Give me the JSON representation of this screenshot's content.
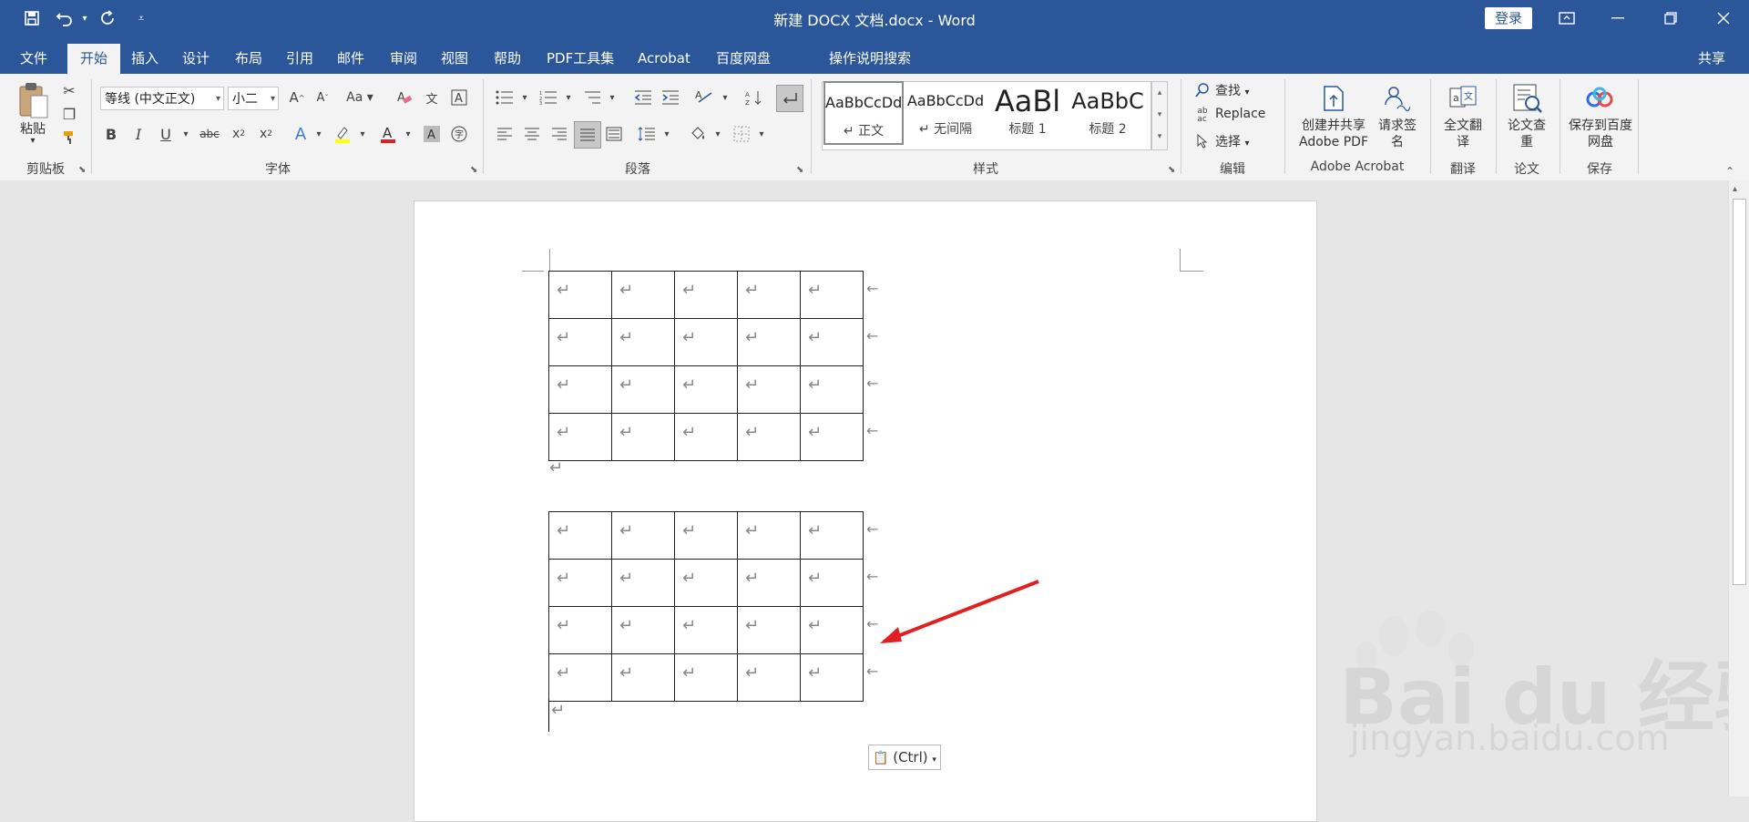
{
  "window": {
    "title": "新建 DOCX 文档.docx  -  Word",
    "login_label": "登录",
    "controls": [
      "—",
      "❐",
      "✕"
    ]
  },
  "quick_access": [
    "save-icon",
    "undo-icon",
    "redo-icon",
    "customize-icon"
  ],
  "menu": {
    "tabs": [
      "文件",
      "开始",
      "插入",
      "设计",
      "布局",
      "引用",
      "邮件",
      "审阅",
      "视图",
      "帮助",
      "PDF工具集",
      "Acrobat",
      "百度网盘"
    ],
    "active_tab": "开始",
    "tell_me": "操作说明搜索",
    "share": "共享"
  },
  "ribbon": {
    "clipboard": {
      "paste_label": "粘贴",
      "group": "剪贴板"
    },
    "font": {
      "font_name": "等线 (中文正文)",
      "font_size": "小二",
      "group": "字体"
    },
    "paragraph": {
      "group": "段落"
    },
    "styles": {
      "group": "样式",
      "items": [
        {
          "sample": "AaBbCcDd",
          "name": "↵ 正文"
        },
        {
          "sample": "AaBbCcDd",
          "name": "↵ 无间隔"
        },
        {
          "sample": "AaBl",
          "name": "标题 1"
        },
        {
          "sample": "AaBbC",
          "name": "标题 2"
        }
      ]
    },
    "editing": {
      "find": "查找",
      "replace": "Replace",
      "select": "选择",
      "group": "编辑"
    },
    "acrobat": {
      "create_pdf": "创建并共享 Adobe PDF",
      "request_sign": "请求签名",
      "group": "Adobe Acrobat"
    },
    "translate": {
      "full_translate": "全文翻译",
      "group": "翻译"
    },
    "paper": {
      "check": "论文查重",
      "group": "论文"
    },
    "save": {
      "save_baidu": "保存到百度网盘",
      "group": "保存"
    }
  },
  "document": {
    "paragraph_mark": "↵",
    "row_end_mark": "←",
    "paste_options": "(Ctrl)",
    "watermark": {
      "brand": "Bai du 经验",
      "url": "jingyan.baidu.com"
    },
    "colors": {
      "arrow": "#e02020",
      "accent": "#2b579a"
    }
  }
}
